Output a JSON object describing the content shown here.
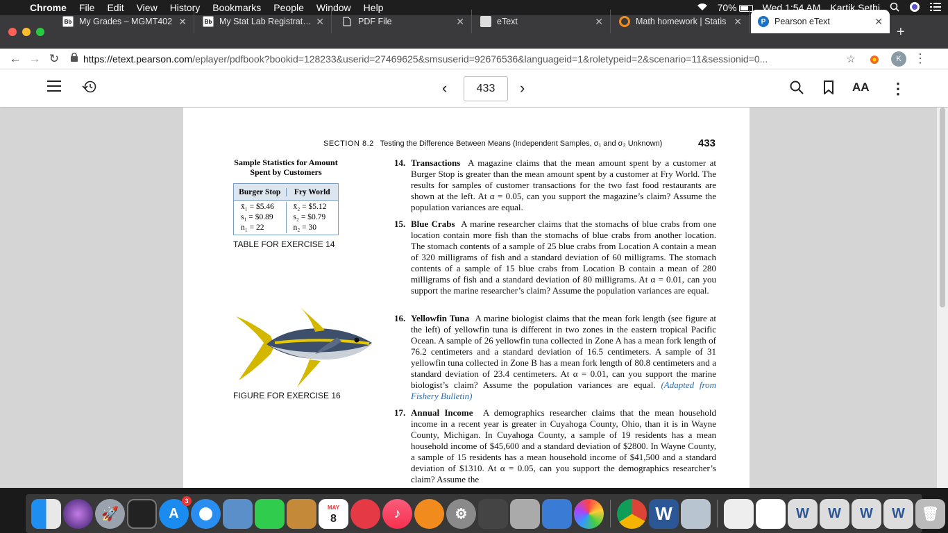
{
  "menubar": {
    "app": "Chrome",
    "items": [
      "File",
      "Edit",
      "View",
      "History",
      "Bookmarks",
      "People",
      "Window",
      "Help"
    ],
    "battery": "70%",
    "clock": "Wed 1:54 AM",
    "user": "Kartik Sethi"
  },
  "tabs": [
    {
      "label": "My Grades – MGMT402",
      "favicon": "Bb"
    },
    {
      "label": "My Stat Lab Registration",
      "favicon": "Bb"
    },
    {
      "label": "PDF File",
      "favicon": "doc"
    },
    {
      "label": "eText",
      "favicon": "doc"
    },
    {
      "label": "Math homework | Statis",
      "favicon": "ring"
    },
    {
      "label": "Pearson eText",
      "favicon": "P"
    }
  ],
  "toolbar": {
    "url_host": "https://etext.pearson.com",
    "url_path": "/eplayer/pdfbook?bookid=128233&userid=27469625&smsuserid=92676536&languageid=1&roletypeid=2&scenario=11&sessionid=0...",
    "avatar_initial": "K"
  },
  "reader": {
    "page_number": "433"
  },
  "page": {
    "section_label": "SECTION 8.2",
    "section_title": "Testing the Difference Between Means (Independent Samples, σ₁ and σ₂ Unknown)",
    "page_number": "433",
    "table_title": "Sample Statistics for Amount Spent by Customers",
    "table_headers": [
      "Burger Stop",
      "Fry World"
    ],
    "table_col1": [
      "x̄₁ = $5.46",
      "s₁ = $0.89",
      "n₁ = 22"
    ],
    "table_col2": [
      "x̄₂ = $5.12",
      "s₂ = $0.79",
      "n₂ = 30"
    ],
    "table_caption": "TABLE FOR EXERCISE 14",
    "figure_caption": "FIGURE FOR EXERCISE 16",
    "problems": [
      {
        "num": "14.",
        "title": "Transactions",
        "body": "A magazine claims that the mean amount spent by a customer at Burger Stop is greater than the mean amount spent by a customer at Fry World. The results for samples of customer transactions for the two fast food restaurants are shown at the left. At α = 0.05, can you support the magazine’s claim? Assume the population variances are equal.",
        "source": ""
      },
      {
        "num": "15.",
        "title": "Blue Crabs",
        "body": "A marine researcher claims that the stomachs of blue crabs from one location contain more fish than the stomachs of blue crabs from another location. The stomach contents of a sample of 25 blue crabs from Location A contain a mean of 320 milligrams of fish and a standard deviation of 60 milligrams. The stomach contents of a sample of 15 blue crabs from Location B contain a mean of 280 milligrams of fish and a standard deviation of 80 milligrams. At α = 0.01, can you support the marine researcher’s claim? Assume the population variances are equal.",
        "source": ""
      },
      {
        "num": "16.",
        "title": "Yellowfin Tuna",
        "body": "A marine biologist claims that the mean fork length (see figure at the left) of yellowfin tuna is different in two zones in the eastern tropical Pacific Ocean. A sample of 26 yellowfin tuna collected in Zone A has a mean fork length of 76.2 centimeters and a standard deviation of 16.5 centimeters. A sample of 31 yellowfin tuna collected in Zone B has a mean fork length of 80.8 centimeters and a standard deviation of 23.4 centimeters. At α = 0.01, can you support the marine biologist’s claim? Assume the population variances are equal.",
        "source": "(Adapted from Fishery Bulletin)"
      },
      {
        "num": "17.",
        "title": "Annual Income",
        "body": "A demographics researcher claims that the mean household income in a recent year is greater in Cuyahoga County, Ohio, than it is in Wayne County, Michigan. In Cuyahoga County, a sample of 19 residents has a mean household income of $45,600 and a standard deviation of $2800. In Wayne County, a sample of 15 residents has a mean household income of $41,500 and a standard deviation of $1310. At α = 0.05, can you support the demographics researcher’s claim? Assume the",
        "source": ""
      }
    ]
  },
  "dock": {
    "calendar_month": "MAY",
    "calendar_day": "8",
    "appstore_badge": "3"
  }
}
